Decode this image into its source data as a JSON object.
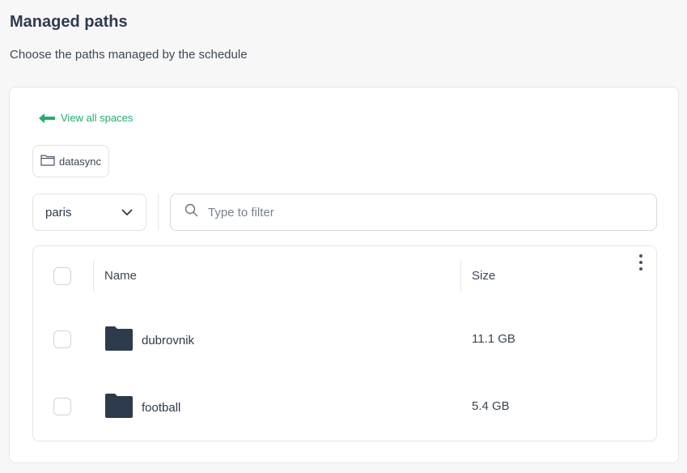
{
  "header": {
    "title": "Managed paths",
    "subtitle": "Choose the paths managed by the schedule"
  },
  "nav": {
    "back_label": "View all spaces"
  },
  "breadcrumb": {
    "chip_label": "datasync"
  },
  "location_select": {
    "value": "paris"
  },
  "filter": {
    "placeholder": "Type to filter",
    "value": ""
  },
  "table": {
    "columns": [
      "Name",
      "Size"
    ],
    "rows": [
      {
        "name": "dubrovnik",
        "size": "11.1 GB",
        "icon": "folder-icon"
      },
      {
        "name": "football",
        "size": "5.4 GB",
        "icon": "folder-icon"
      }
    ]
  },
  "colors": {
    "accent": "#1fae6c",
    "folder": "#2e3b4e"
  }
}
